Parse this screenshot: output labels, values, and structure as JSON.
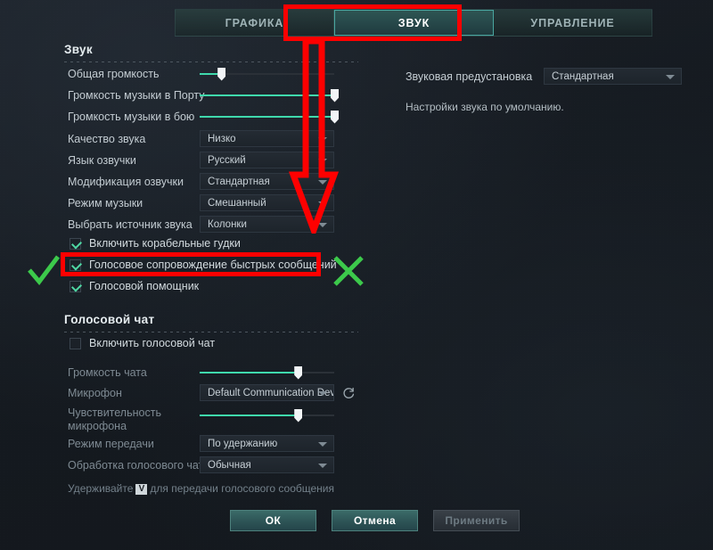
{
  "tabs": [
    {
      "label": "ГРАФИКА",
      "active": false
    },
    {
      "label": "ЗВУК",
      "active": true
    },
    {
      "label": "УПРАВЛЕНИЕ",
      "active": false
    }
  ],
  "sound_section": {
    "title": "Звук",
    "sliders": [
      {
        "label": "Общая громкость",
        "value": 16
      },
      {
        "label": "Громкость музыки в Порту",
        "value": 100
      },
      {
        "label": "Громкость музыки в бою",
        "value": 100
      }
    ],
    "dropdowns": [
      {
        "label": "Качество звука",
        "value": "Низко"
      },
      {
        "label": "Язык озвучки",
        "value": "Русский"
      },
      {
        "label": "Модификация озвучки",
        "value": "Стандартная"
      },
      {
        "label": "Режим музыки",
        "value": "Смешанный"
      },
      {
        "label": "Выбрать источник звука",
        "value": "Колонки"
      }
    ],
    "checkboxes": [
      {
        "label": "Включить корабельные гудки",
        "checked": true
      },
      {
        "label": "Голосовое сопровождение быстрых сообщений",
        "checked": true
      },
      {
        "label": "Голосовой помощник",
        "checked": true
      }
    ]
  },
  "voice_section": {
    "title": "Голосовой чат",
    "enable_checkbox": {
      "label": "Включить голосовой чат",
      "checked": false
    },
    "chat_volume": {
      "label": "Громкость чата",
      "value": 73
    },
    "microphone": {
      "label": "Микрофон",
      "value": "Default Communication Device",
      "refresh_icon": "refresh-icon"
    },
    "mic_sensitivity": {
      "label_line1": "Чувствительность",
      "label_line2": "микрофона",
      "value": 73
    },
    "transmit_mode": {
      "label": "Режим передачи",
      "value": "По удержанию"
    },
    "processing": {
      "label": "Обработка голосового чата",
      "value": "Обычная"
    },
    "hint": {
      "before": "Удерживайте",
      "key": "V",
      "after": "для передачи голосового сообщения"
    }
  },
  "preset_panel": {
    "label": "Звуковая предустановка",
    "value": "Стандартная",
    "description": "Настройки звука по умолчанию."
  },
  "footer_buttons": [
    {
      "label": "ОК",
      "disabled": false
    },
    {
      "label": "Отмена",
      "disabled": false
    },
    {
      "label": "Применить",
      "disabled": true
    }
  ],
  "annotations": {
    "red_color": "#fe0000",
    "green_color": "#3cc94b",
    "tab_highlight_box": "red-box-around-sound-tab",
    "arrow": "red-down-arrow",
    "checkbox_highlight_box": "red-box-around-quick-messages-checkbox",
    "check_mark": "green-check-mark",
    "cross_mark": "green-cross-mark"
  },
  "colors": {
    "accent_green": "#3fd9ac",
    "tab_active_border": "#49a6a0",
    "background": "#15191f"
  }
}
